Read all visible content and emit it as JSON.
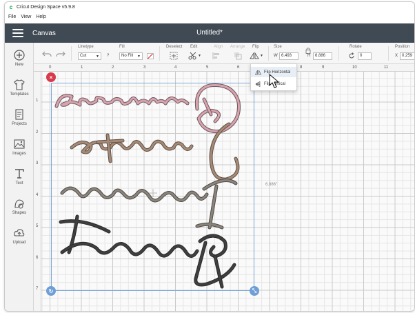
{
  "app": {
    "logo_letter": "c",
    "window_title": "Cricut Design Space  v5.9.8",
    "menu": [
      "File",
      "View",
      "Help"
    ]
  },
  "header": {
    "section": "Canvas",
    "document_title": "Untitled*"
  },
  "sidebar": {
    "items": [
      {
        "label": "New",
        "icon": "plus-circle-icon"
      },
      {
        "label": "Templates",
        "icon": "tshirt-icon"
      },
      {
        "label": "Projects",
        "icon": "projects-icon"
      },
      {
        "label": "Images",
        "icon": "image-icon"
      },
      {
        "label": "Text",
        "icon": "text-icon"
      },
      {
        "label": "Shapes",
        "icon": "shapes-icon"
      },
      {
        "label": "Upload",
        "icon": "upload-icon"
      }
    ]
  },
  "toolbar": {
    "linetype_label": "Linetype",
    "linetype_value": "Cut",
    "help_label": "?",
    "fill_label": "Fill",
    "fill_value": "No Fill",
    "deselect_label": "Deselect",
    "edit_label": "Edit",
    "align_label": "Align",
    "arrange_label": "Arrange",
    "flip_label": "Flip",
    "size_label": "Size",
    "size_w_label": "W",
    "size_w_value": "6.493",
    "size_h_label": "H",
    "size_h_value": "6.886",
    "rotate_label": "Rotate",
    "rotate_value": "0",
    "position_label": "Position",
    "position_x_label": "X",
    "position_x_value": "0.259"
  },
  "rulers": {
    "top": [
      "0",
      "1",
      "2",
      "3",
      "4",
      "5",
      "6",
      "7",
      "8",
      "9",
      "10",
      "11"
    ],
    "left": [
      "1",
      "2",
      "3",
      "4",
      "5",
      "6",
      "7"
    ]
  },
  "flip_menu": {
    "items": [
      "Flip Horizontal",
      "Flip Vertical"
    ]
  },
  "canvas": {
    "height_readout": "6.886\"",
    "words": [
      "Dream",
      "Create",
      "Inspire",
      "Repeat"
    ],
    "colors": {
      "dream": "#d9a3ad",
      "create": "#a68a77",
      "inspire": "#8a847c",
      "repeat": "#3f3f3f",
      "selection": "#7aa7d8",
      "delete_handle": "#d83a4c",
      "handle": "#6f9fd6"
    }
  }
}
